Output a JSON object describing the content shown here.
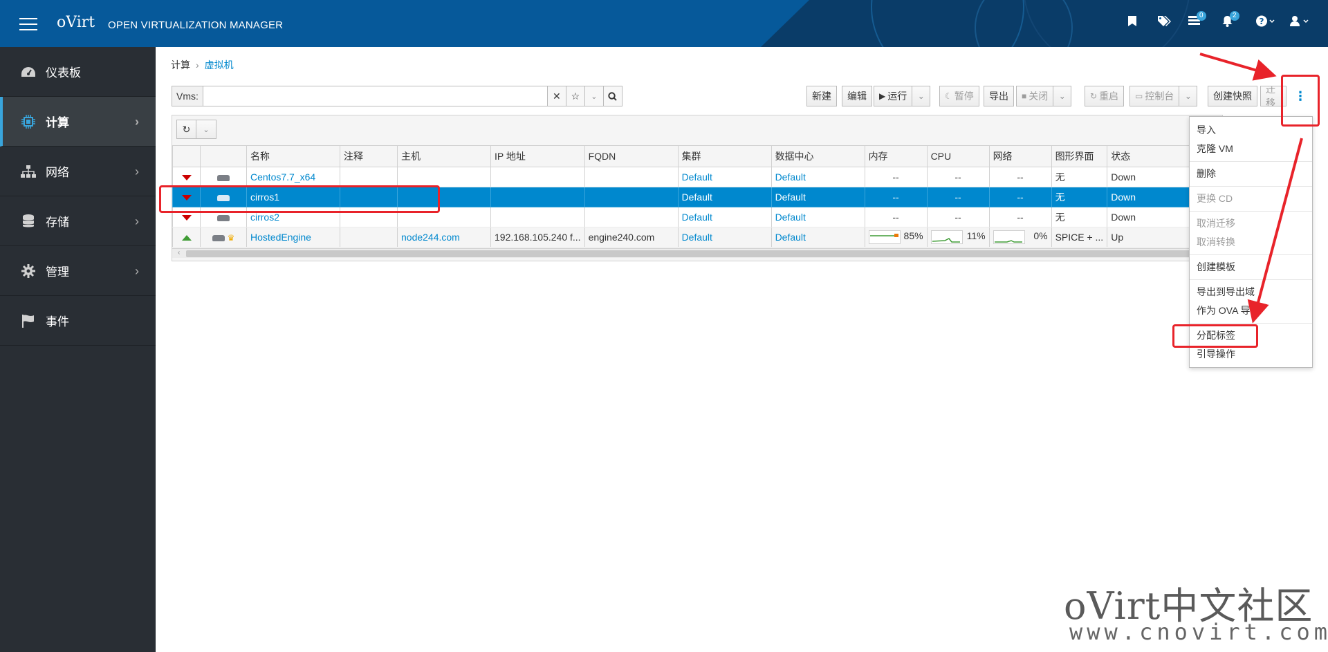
{
  "header": {
    "brand": "oVirt",
    "subtitle": "OPEN VIRTUALIZATION MANAGER",
    "tasks_badge": "0",
    "alerts_badge": "2"
  },
  "sidebar": {
    "items": [
      {
        "label": "仪表板",
        "icon": "dashboard-icon",
        "active": false
      },
      {
        "label": "计算",
        "icon": "cpu-icon",
        "active": true
      },
      {
        "label": "网络",
        "icon": "network-icon",
        "active": false
      },
      {
        "label": "存储",
        "icon": "database-icon",
        "active": false
      },
      {
        "label": "管理",
        "icon": "gear-icon",
        "active": false
      },
      {
        "label": "事件",
        "icon": "flag-icon",
        "active": false
      }
    ]
  },
  "breadcrumb": {
    "parent": "计算",
    "current": "虚拟机"
  },
  "search": {
    "label": "Vms:",
    "value": ""
  },
  "toolbar": {
    "new": "新建",
    "edit": "编辑",
    "run": "运行",
    "pause": "暂停",
    "export": "导出",
    "shutdown": "关闭",
    "reboot": "重启",
    "console": "控制台",
    "snapshot": "创建快照",
    "migrate": "迁移"
  },
  "table": {
    "columns": [
      "名称",
      "注释",
      "主机",
      "IP 地址",
      "FQDN",
      "集群",
      "数据中心",
      "内存",
      "CPU",
      "网络",
      "图形界面",
      "状态"
    ],
    "rows": [
      {
        "status": "down",
        "name": "Centos7.7_x64",
        "comment": "",
        "host": "",
        "ip": "",
        "fqdn": "",
        "cluster": "Default",
        "datacenter": "Default",
        "memory": "--",
        "cpu": "--",
        "network": "--",
        "graphics": "无",
        "state": "Down",
        "selected": false,
        "hosted": false
      },
      {
        "status": "down",
        "name": "cirros1",
        "comment": "",
        "host": "",
        "ip": "",
        "fqdn": "",
        "cluster": "Default",
        "datacenter": "Default",
        "memory": "--",
        "cpu": "--",
        "network": "--",
        "graphics": "无",
        "state": "Down",
        "selected": true,
        "hosted": false
      },
      {
        "status": "down",
        "name": "cirros2",
        "comment": "",
        "host": "",
        "ip": "",
        "fqdn": "",
        "cluster": "Default",
        "datacenter": "Default",
        "memory": "--",
        "cpu": "--",
        "network": "--",
        "graphics": "无",
        "state": "Down",
        "selected": false,
        "hosted": false
      },
      {
        "status": "up",
        "name": "HostedEngine",
        "comment": "",
        "host": "node244.com",
        "ip": "192.168.105.240 f...",
        "fqdn": "engine240.com",
        "cluster": "Default",
        "datacenter": "Default",
        "memory": "85%",
        "cpu": "11%",
        "network": "0%",
        "graphics": "SPICE + ...",
        "state": "Up",
        "selected": false,
        "hosted": true
      }
    ]
  },
  "dropdown": {
    "groups": [
      [
        "导入",
        "克隆 VM"
      ],
      [
        "删除"
      ],
      [
        "更换 CD"
      ],
      [
        "取消迁移",
        "取消转换"
      ],
      [
        "创建模板"
      ],
      [
        "导出到导出域",
        "作为 OVA 导出"
      ],
      [
        "分配标签",
        "引导操作"
      ]
    ],
    "disabled": [
      "更换 CD",
      "取消迁移",
      "取消转换"
    ]
  },
  "watermark": {
    "line1": "oVirt中文社区",
    "line2": "www.cnovirt.com"
  },
  "colors": {
    "header": "#06599a",
    "sidebar": "#292e34",
    "accent": "#0088ce",
    "annotation": "#e8232a"
  }
}
